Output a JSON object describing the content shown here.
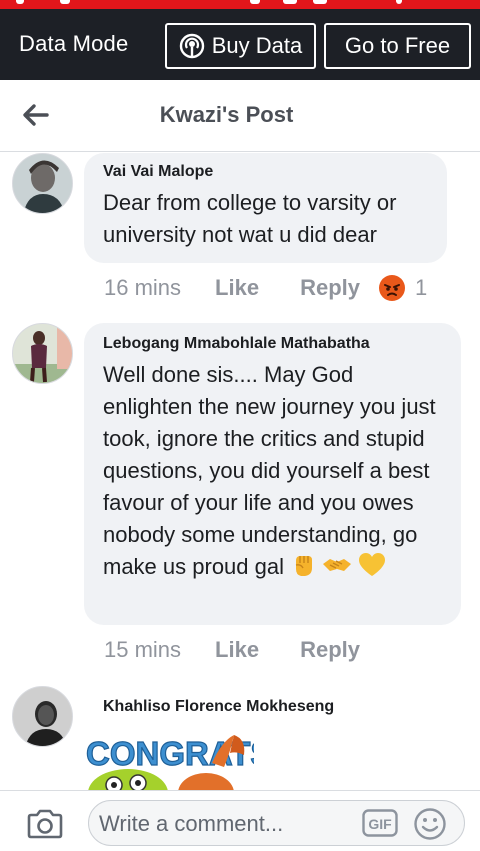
{
  "data_bar": {
    "label": "Data Mode",
    "buy_label": "Buy Data",
    "free_label": "Go to Free"
  },
  "header": {
    "title": "Kwazi's Post"
  },
  "comments": [
    {
      "name": "Vai Vai Malope",
      "text": "Dear from college to varsity or university not wat u did dear",
      "time": "16 mins",
      "like": "Like",
      "reply": "Reply",
      "reaction": "angry",
      "reaction_count": "1"
    },
    {
      "name": "Lebogang Mmabohlale Mathabatha",
      "text": "Well done sis.... May God enlighten the new journey you just took, ignore the critics and stupid questions, you did yourself a best favour of your life and you owes nobody some understanding, go make us proud gal",
      "emojis": [
        "raised-fist",
        "handshake",
        "yellow-heart"
      ],
      "time": "15 mins",
      "like": "Like",
      "reply": "Reply"
    },
    {
      "name": "Khahliso Florence Mokheseng",
      "sticker_text": "CONGRATS!"
    }
  ],
  "composer": {
    "placeholder": "Write a comment...",
    "gif_label": "GIF"
  },
  "colors": {
    "status_bar": "#e2161b",
    "data_bar": "#1d2026",
    "bubble": "#f0f2f5",
    "meta_text": "#90949c"
  }
}
